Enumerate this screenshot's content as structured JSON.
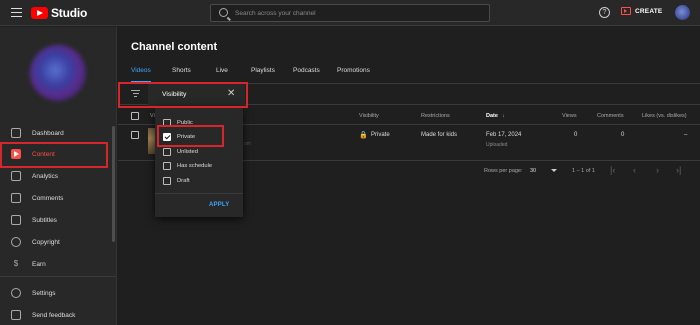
{
  "header": {
    "app_name": "Studio",
    "search_placeholder": "Search across your channel",
    "help_icon": "?",
    "create_label": "CREATE"
  },
  "sidebar": {
    "items": [
      {
        "label": "Dashboard",
        "icon": "dashboard-icon"
      },
      {
        "label": "Content",
        "icon": "content-icon"
      },
      {
        "label": "Analytics",
        "icon": "analytics-icon"
      },
      {
        "label": "Comments",
        "icon": "comments-icon"
      },
      {
        "label": "Subtitles",
        "icon": "subtitles-icon"
      },
      {
        "label": "Copyright",
        "icon": "copyright-icon"
      },
      {
        "label": "Earn",
        "icon": "earn-icon"
      },
      {
        "label": "Settings",
        "icon": "settings-icon"
      },
      {
        "label": "Send feedback",
        "icon": "feedback-icon"
      }
    ],
    "active": "Content"
  },
  "main": {
    "title": "Channel content",
    "tabs": [
      "Videos",
      "Shorts",
      "Live",
      "Playlists",
      "Podcasts",
      "Promotions"
    ],
    "active_tab": "Videos",
    "columns": {
      "video": "Vi",
      "visibility": "Visibility",
      "restrictions": "Restrictions",
      "date": "Date",
      "date_sort_icon": "↓",
      "views": "Views",
      "comments": "Comments",
      "likes": "Likes (vs. dislikes)"
    },
    "row": {
      "visibility": "Private",
      "restrictions": "Made for kids",
      "date": "Feb 17, 2024",
      "date_status": "Uploaded",
      "views": "0",
      "comments": "0",
      "likes": "–",
      "thumb_text": "om"
    },
    "pager": {
      "rows_label": "Rows per page:",
      "rows_value": "30",
      "range": "1 – 1 of 1"
    }
  },
  "filter": {
    "title": "Visibility",
    "close": "✕",
    "options": [
      {
        "label": "Public",
        "checked": false
      },
      {
        "label": "Private",
        "checked": true
      },
      {
        "label": "Unlisted",
        "checked": false
      },
      {
        "label": "Has schedule",
        "checked": false
      },
      {
        "label": "Draft",
        "checked": false
      }
    ],
    "apply_label": "APPLY"
  },
  "colors": {
    "accent_red": "#ff4e45",
    "link_blue": "#3ea6ff",
    "highlight_red": "#d6262b"
  }
}
